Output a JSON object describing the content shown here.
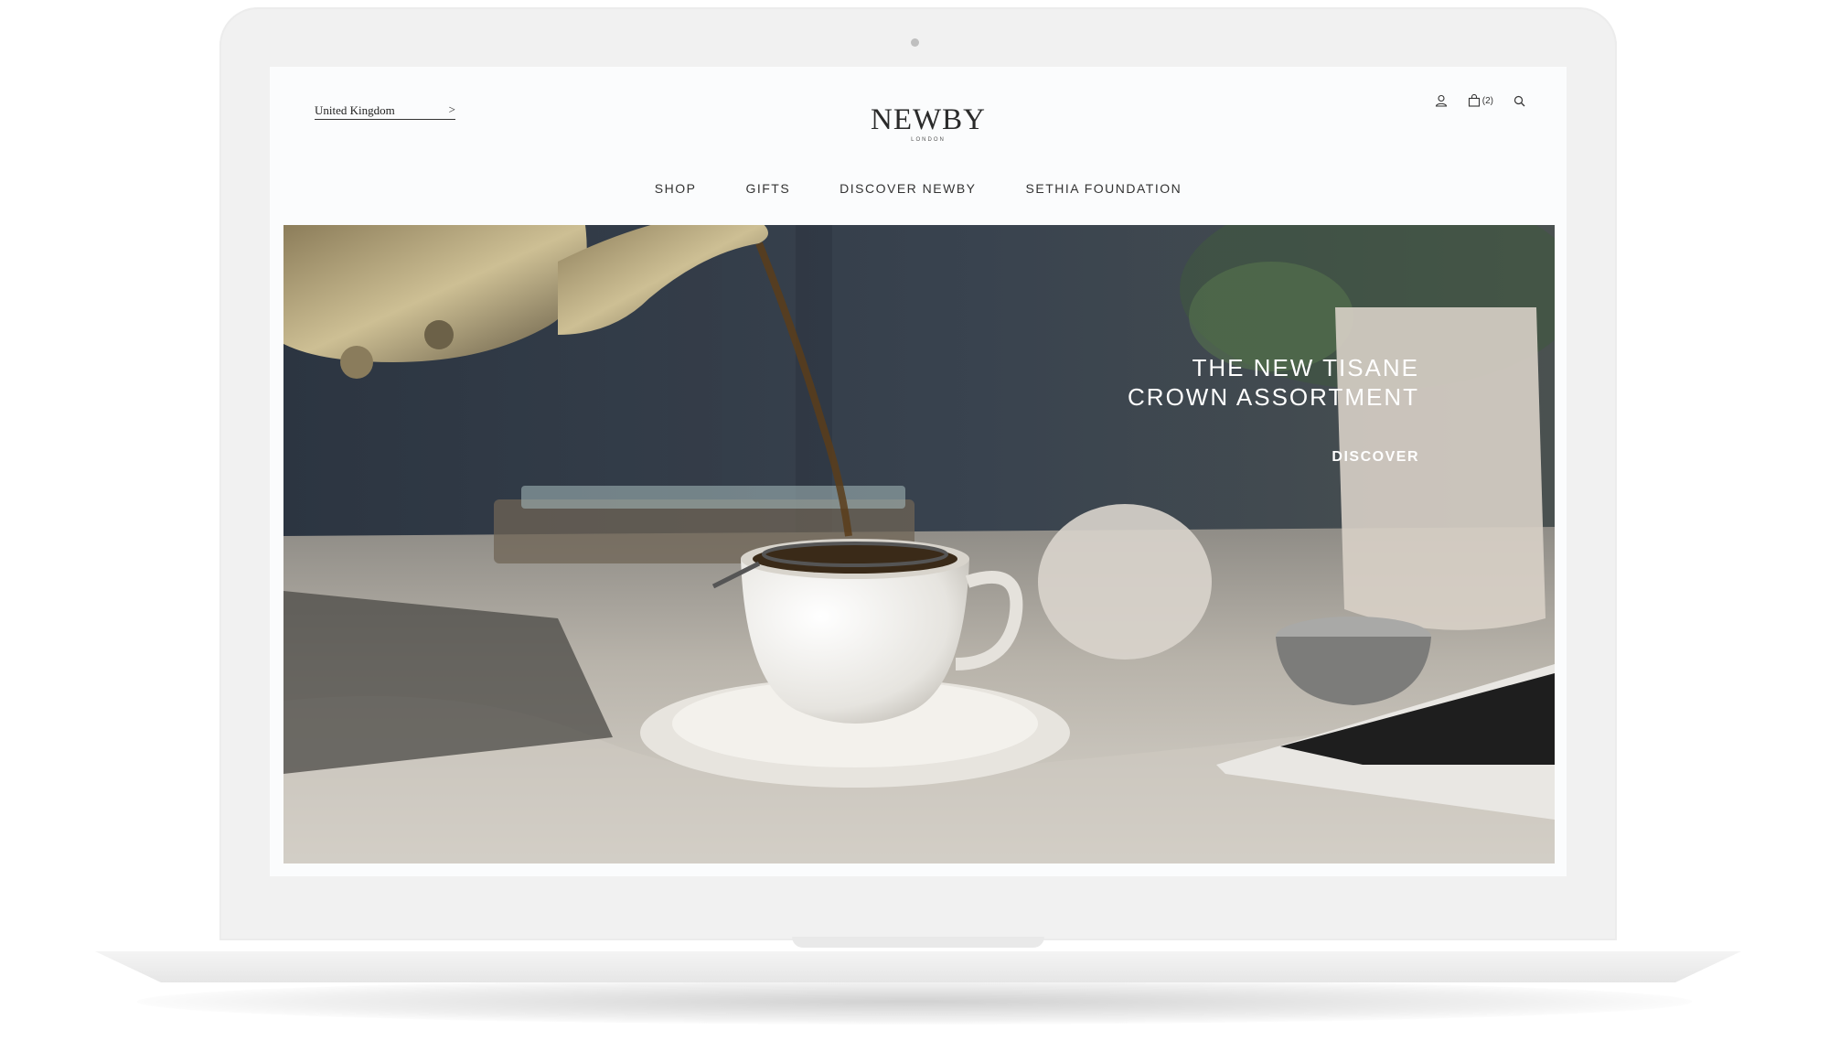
{
  "header": {
    "country": "United Kingdom",
    "logo_main": "NEWBY",
    "logo_sub": "LONDON",
    "cart_count": "(2)"
  },
  "nav": {
    "items": [
      {
        "label": "SHOP"
      },
      {
        "label": "GIFTS"
      },
      {
        "label": "DISCOVER NEWBY"
      },
      {
        "label": "SETHIA FOUNDATION"
      }
    ]
  },
  "hero": {
    "title_line1": "THE NEW TISANE",
    "title_line2": "CROWN ASSORTMENT",
    "cta": "DISCOVER"
  },
  "icons": {
    "account": "user-icon",
    "cart": "bag-icon",
    "search": "search-icon",
    "country_arrow": "chevron-right-icon"
  }
}
